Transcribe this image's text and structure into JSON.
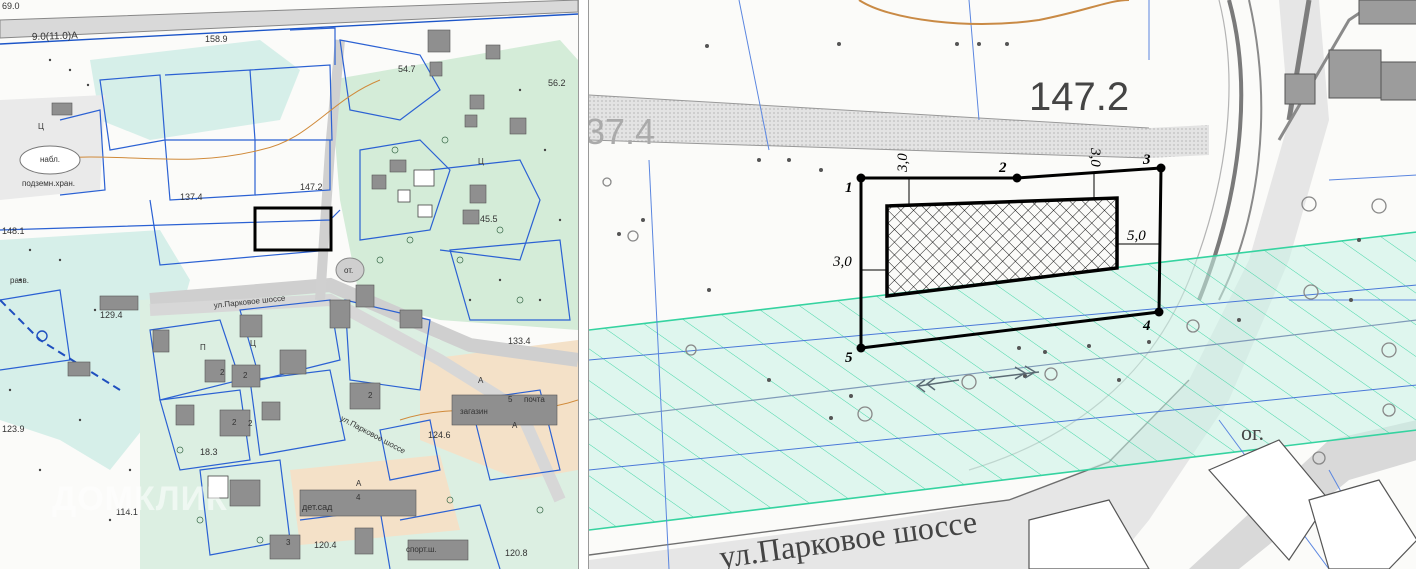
{
  "watermark": "ДОМКЛИК",
  "left_map": {
    "road_top_label": "9.0(11.0)А",
    "top_left_elev": "69.0",
    "elevations": [
      "158.9",
      "54.7",
      "56.2",
      "137.4",
      "147.2",
      "148.1",
      "45.5",
      "129.4",
      "133.4",
      "123.9",
      "124.6",
      "114.1",
      "120.4",
      "120.8",
      "18.3"
    ],
    "small_labels": [
      "Ц",
      "набл.",
      "подземн.хран.",
      "разв.",
      "от.",
      "Ц",
      "дет.сад",
      "загазин",
      "почта",
      "спорт.ш.",
      "Ц",
      "П"
    ],
    "street_labels": [
      "ул.Парковое шоссе",
      "ул.Парковое шоссе"
    ],
    "building_numbers": [
      "2",
      "2",
      "2",
      "2",
      "4",
      "5",
      "А",
      "А",
      "А",
      "3",
      "2"
    ]
  },
  "right_map": {
    "elevation_main": "147.2",
    "elevation_cut": "37.4",
    "street": "ул.Парковое шоссе",
    "landuse": "ог.",
    "points": [
      "1",
      "2",
      "3",
      "4",
      "5"
    ],
    "dims": [
      "3,0",
      "3,0",
      "5,0",
      "3,0"
    ]
  }
}
